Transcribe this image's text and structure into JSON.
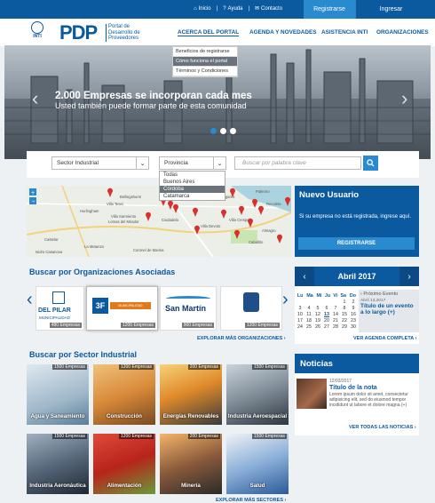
{
  "topbar": {
    "inicio": "Inicio",
    "ayuda": "Ayuda",
    "contacto": "Contacto",
    "registrarse": "Registrarse",
    "ingresar": "Ingresar"
  },
  "brand": {
    "inti": "INTI",
    "pdp": "PDP",
    "subtitle_1": "Portal de",
    "subtitle_2": "Desarrollo de",
    "subtitle_3": "Proveedores"
  },
  "menu": {
    "acerca": "ACERCA DEL PORTAL",
    "agenda": "AGENDA Y NOVEDADES",
    "asistencia": "ASISTENCIA INTI",
    "organizaciones": "ORGANIZACIONES"
  },
  "dropdown": [
    "Beneficios de registrarse",
    "Cómo funciona el portal",
    "Términos y Condiciones"
  ],
  "hero": {
    "title": "2.000 Empresas se incorporan cada mes",
    "subtitle": "Usted también puede formar parte de esta comunidad"
  },
  "search": {
    "sector": "Sector Industrial",
    "provincia": "Provincia",
    "placeholder": "Buscar por palabra clave",
    "provincias": [
      "Todas",
      "Buenos Aires",
      "Córdoba",
      "Catamarca"
    ]
  },
  "map": {
    "labels": [
      "Bellingshurst",
      "Villa Tesei",
      "Hurlingham",
      "Villa Sarmiento",
      "Lomas del Mirador",
      "Caseros",
      "Santos Lugares",
      "Ciudadela",
      "Villa Devoto",
      "Palermo",
      "Recoleta",
      "Caballito",
      "Almagro",
      "Villa Crespo",
      "Castelar",
      "La Matanza",
      "Coronel de Marina",
      "Isidro Casanova"
    ]
  },
  "newuser": {
    "title": "Nuevo Usuario",
    "text": "Si su empresa no está registrada, ingrese aquí.",
    "button": "REGISTRARSE"
  },
  "orgs": {
    "title": "Buscar por Organizaciones Asociadas",
    "items": [
      {
        "name": "DEL PILAR",
        "sub": "MUNICIPALIDAD",
        "count": "480 Empresas"
      },
      {
        "name": "3F",
        "sub": "MUNICIPALIDAD",
        "count": "1200 Empresas"
      },
      {
        "name": "San Martín",
        "sub": "",
        "count": "900 Empresas"
      },
      {
        "name": "",
        "sub": "",
        "count": "1200 Empresas"
      }
    ],
    "more": "EXPLORAR MÁS ORGANIZACIONES"
  },
  "calendar": {
    "month": "Abril 2017",
    "days": [
      "Lu",
      "Ma",
      "Mi",
      "Ju",
      "Vi",
      "Sa",
      "Do"
    ],
    "weeks": [
      [
        "",
        "",
        "",
        "",
        "",
        "1",
        "2"
      ],
      [
        "3",
        "4",
        "5",
        "6",
        "7",
        "8",
        "9"
      ],
      [
        "10",
        "11",
        "12",
        "13",
        "14",
        "15",
        "16"
      ],
      [
        "17",
        "18",
        "19",
        "20",
        "21",
        "22",
        "23"
      ],
      [
        "24",
        "25",
        "26",
        "27",
        "28",
        "29",
        "30"
      ]
    ],
    "next_label": "Próximo Evento",
    "event_date": "Abril 13,2017",
    "event_title": "Título de un evento a lo largo (+)",
    "more": "VER AGENDA COMPLETA"
  },
  "sectors": {
    "title": "Buscar por Sector Industrial",
    "items": [
      {
        "label": "Agua y Saneamiento",
        "count": "1500 Empresas"
      },
      {
        "label": "Construcción",
        "count": "1200 Empresas"
      },
      {
        "label": "Energías Renovables",
        "count": "200 Empresas"
      },
      {
        "label": "Industria Aeroespacial",
        "count": "1500 Empresas"
      },
      {
        "label": "Industria Aeronáutica",
        "count": "1500 Empresas"
      },
      {
        "label": "Alimentación",
        "count": "1200 Empresas"
      },
      {
        "label": "Minería",
        "count": "200 Empresas"
      },
      {
        "label": "Salud",
        "count": "1500 Empresas"
      }
    ],
    "more": "EXPLORAR MÁS SECTORES"
  },
  "news": {
    "title": "Noticias",
    "date": "12/03/2017",
    "headline": "Título de la nota",
    "body": "Lorem ipsum dolor sit amet, consectetur adipisicing elit, sed do eiusmod tempor incididunt ut labore et dolore magna (+)",
    "more": "VER TODAS LAS NOTICIAS"
  },
  "colors": {
    "primary": "#0b5aa0",
    "accent": "#2a8ad0"
  }
}
